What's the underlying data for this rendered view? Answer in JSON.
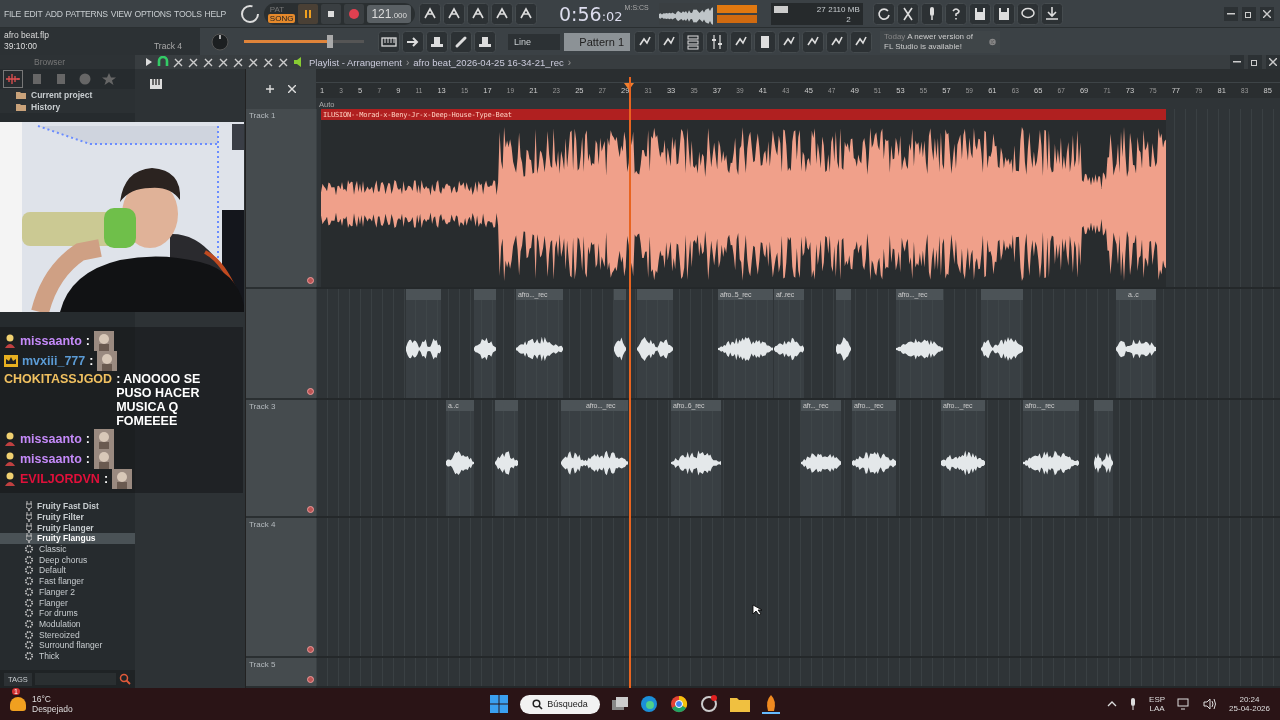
{
  "menu": [
    "FILE",
    "EDIT",
    "ADD",
    "PATTERNS",
    "VIEW",
    "OPTIONS",
    "TOOLS",
    "HELP"
  ],
  "transport": {
    "pat": "PAT",
    "song": "SONG",
    "song_selected": true,
    "playing": true,
    "tempo": "121",
    "tempo_decimals": ".000",
    "time": "0:56",
    "time_cs": ":02",
    "time_unit": "M:S:CS"
  },
  "project": {
    "file": "afro beat.flp",
    "position": "39:10:00",
    "track": "Track 4"
  },
  "master_volume": {
    "level": 0.72
  },
  "cpu": {
    "voices": "27",
    "memory": "2110 MB",
    "count": "2"
  },
  "snap": "Line",
  "pattern": "Pattern 1",
  "news": {
    "label": "Today",
    "text": "A newer version of FL Studio is available!"
  },
  "browser": {
    "title": "Browser",
    "items": [
      {
        "label": "Current project",
        "kind": "folder",
        "selected": false
      },
      {
        "label": "History",
        "kind": "folder",
        "selected": false
      },
      {
        "label": "Fruity Fast Dist",
        "kind": "plugin",
        "selected": false
      },
      {
        "label": "Fruity Filter",
        "kind": "plugin",
        "selected": false
      },
      {
        "label": "Fruity Flanger",
        "kind": "plugin",
        "selected": false
      },
      {
        "label": "Fruity Flangus",
        "kind": "plugin",
        "selected": true
      },
      {
        "label": "Classic",
        "kind": "preset",
        "selected": false
      },
      {
        "label": "Deep chorus",
        "kind": "preset",
        "selected": false
      },
      {
        "label": "Default",
        "kind": "preset",
        "selected": false
      },
      {
        "label": "Fast flanger",
        "kind": "preset",
        "selected": false
      },
      {
        "label": "Flanger 2",
        "kind": "preset",
        "selected": false
      },
      {
        "label": "Flanger",
        "kind": "preset",
        "selected": false
      },
      {
        "label": "For drums",
        "kind": "preset",
        "selected": false
      },
      {
        "label": "Modulation",
        "kind": "preset",
        "selected": false
      },
      {
        "label": "Stereoized",
        "kind": "preset",
        "selected": false
      },
      {
        "label": "Surround flanger",
        "kind": "preset",
        "selected": false
      },
      {
        "label": "Thick",
        "kind": "preset",
        "selected": false
      }
    ],
    "tags_label": "TAGS"
  },
  "playlist": {
    "title": "Playlist - Arrangement",
    "file": "afro beat_2026-04-25 16-34-21_rec",
    "arrows": [
      "›",
      "›"
    ],
    "auto_label": "Auto",
    "ruler": [
      "1",
      "3",
      "5",
      "7",
      "9",
      "11",
      "13",
      "15",
      "17",
      "19",
      "21",
      "23",
      "25",
      "27",
      "29",
      "31",
      "33",
      "35",
      "37",
      "39",
      "41",
      "43",
      "45",
      "47",
      "49",
      "51",
      "53",
      "55",
      "57",
      "59",
      "61",
      "63",
      "65",
      "67",
      "69",
      "71",
      "73",
      "75",
      "77",
      "79",
      "81",
      "83",
      "85"
    ],
    "playhead": {
      "level": 0.325
    },
    "tracks": [
      {
        "name": "Track 1",
        "clips": [
          {
            "label": "ILUSION--Morad-x-Beny-Jr-x-Deep-House-Type-Beat",
            "selected": true
          }
        ]
      },
      {
        "clips": [
          {
            "selected": false
          },
          {
            "selected": false
          },
          {
            "selected": false
          },
          {
            "selected": false
          },
          {
            "label": "afro..._rec",
            "selected": false
          },
          {
            "selected": false
          },
          {
            "selected": false
          },
          {
            "selected": false
          },
          {
            "label": "afro..5_rec",
            "selected": false
          },
          {
            "label": "af..rec",
            "selected": false
          },
          {
            "selected": false
          },
          {
            "label": "afro..._rec",
            "selected": false
          },
          {
            "selected": false
          },
          {
            "selected": false
          },
          {
            "selected": false
          },
          {
            "label": "a..c",
            "selected": false
          }
        ]
      },
      {
        "name": "Track 3",
        "clips": [
          {
            "label": "a..c",
            "selected": false
          },
          {
            "selected": false
          },
          {
            "selected": false
          },
          {
            "label": "afro..._rec",
            "selected": false
          },
          {
            "label": "afro..6_rec",
            "selected": false
          },
          {
            "label": "afr..._rec",
            "selected": false
          },
          {
            "label": "afro..._rec",
            "selected": false
          },
          {
            "label": "afro..._rec",
            "selected": false
          },
          {
            "label": "afro..._rec",
            "selected": false
          },
          {
            "selected": false
          },
          {
            "selected": false
          }
        ]
      },
      {
        "name": "Track 4"
      },
      {
        "name": "Track 5"
      }
    ]
  },
  "chat": [
    {
      "kind": "person",
      "user": "missaanto",
      "color": "#c58af9",
      "text": ":",
      "emote": true
    },
    {
      "kind": "crown",
      "user": "mvxiii_777",
      "color": "#5b9bd5",
      "text": ":",
      "emote": true
    },
    {
      "kind": "plain",
      "user": "CHOKITASSJGOD",
      "color": "#f0c060",
      "text": ": ANOOOO SE PUSO HACER MUSICA Q FOMEEEE",
      "emote": false
    },
    {
      "kind": "person",
      "user": "missaanto",
      "color": "#c58af9",
      "text": ":",
      "emote": true
    },
    {
      "kind": "person",
      "user": "missaanto",
      "color": "#c58af9",
      "text": ":",
      "emote": true
    },
    {
      "kind": "person",
      "user": "EVILJORDVN",
      "color": "#e0103a",
      "text": ":",
      "emote": true
    }
  ],
  "taskbar": {
    "weather_badge": "1",
    "temperature": "16°C",
    "condition": "Despejado",
    "search": "Búsqueda",
    "language": "ESP",
    "layout": "LAA",
    "time": "20:24",
    "date": "25-04-2026"
  }
}
